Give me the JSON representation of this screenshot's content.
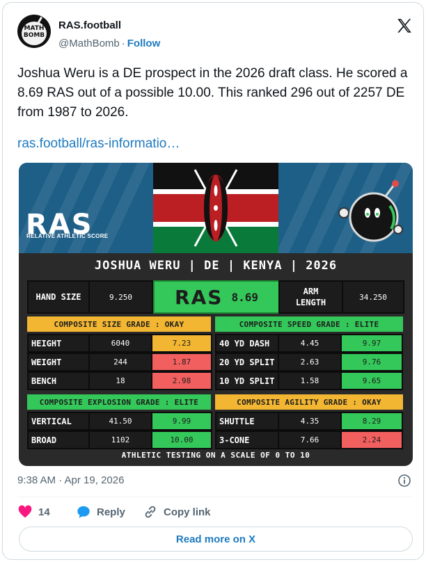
{
  "author": {
    "display_name": "RAS.football",
    "handle": "@MathBomb",
    "separator": "·",
    "follow_label": "Follow",
    "avatar_text": "MATH BOMB"
  },
  "tweet": {
    "text": "Joshua Weru is a DE prospect in the 2026 draft class. He scored a 8.69 RAS out of a possible 10.00. This ranked 296 out of 2257 DE from 1987 to 2026.",
    "link": "ras.football/ras-informatio…",
    "timestamp": "9:38 AM · Apr 19, 2026"
  },
  "graphic": {
    "logo": "RAS",
    "logo_sub": "RELATIVE ATHLETIC SCORE",
    "title": "JOSHUA WERU | DE | KENYA | 2026",
    "hand_size_label": "HAND SIZE",
    "hand_size_value": "9.250",
    "ras_logo": "RAS",
    "ras_value": "8.69",
    "arm_length_label": "ARM LENGTH",
    "arm_length_value": "34.250",
    "grades": {
      "size": "COMPOSITE SIZE GRADE : OKAY",
      "speed": "COMPOSITE SPEED GRADE : ELITE",
      "explosion": "COMPOSITE EXPLOSION GRADE : ELITE",
      "agility": "COMPOSITE AGILITY GRADE : OKAY"
    },
    "size_metrics": [
      {
        "label": "HEIGHT",
        "raw": "6040",
        "score": "7.23",
        "rating": "yellow"
      },
      {
        "label": "WEIGHT",
        "raw": "244",
        "score": "1.87",
        "rating": "red"
      },
      {
        "label": "BENCH",
        "raw": "18",
        "score": "2.98",
        "rating": "red"
      }
    ],
    "speed_metrics": [
      {
        "label": "40 YD DASH",
        "raw": "4.45",
        "score": "9.97",
        "rating": "green"
      },
      {
        "label": "20 YD SPLIT",
        "raw": "2.63",
        "score": "9.76",
        "rating": "green"
      },
      {
        "label": "10 YD SPLIT",
        "raw": "1.58",
        "score": "9.65",
        "rating": "green"
      }
    ],
    "explosion_metrics": [
      {
        "label": "VERTICAL",
        "raw": "41.50",
        "score": "9.99",
        "rating": "green"
      },
      {
        "label": "BROAD",
        "raw": "1102",
        "score": "10.00",
        "rating": "green"
      }
    ],
    "agility_metrics": [
      {
        "label": "SHUTTLE",
        "raw": "4.35",
        "score": "8.29",
        "rating": "green"
      },
      {
        "label": "3-CONE",
        "raw": "7.66",
        "score": "2.24",
        "rating": "red"
      }
    ],
    "footer": "ATHLETIC TESTING ON A SCALE OF 0 TO 10",
    "colors": {
      "elite": "#34c759",
      "okay": "#f2b632",
      "poor": "#f25f5f",
      "kenya_red": "#bb1e23",
      "kenya_green": "#0a7a3a"
    }
  },
  "actions": {
    "likes": "14",
    "reply_label": "Reply",
    "copy_link_label": "Copy link"
  },
  "read_more_label": "Read more on X",
  "icons": [
    "x-logo-icon",
    "info-icon",
    "heart-icon",
    "reply-bubble-icon",
    "link-icon"
  ]
}
